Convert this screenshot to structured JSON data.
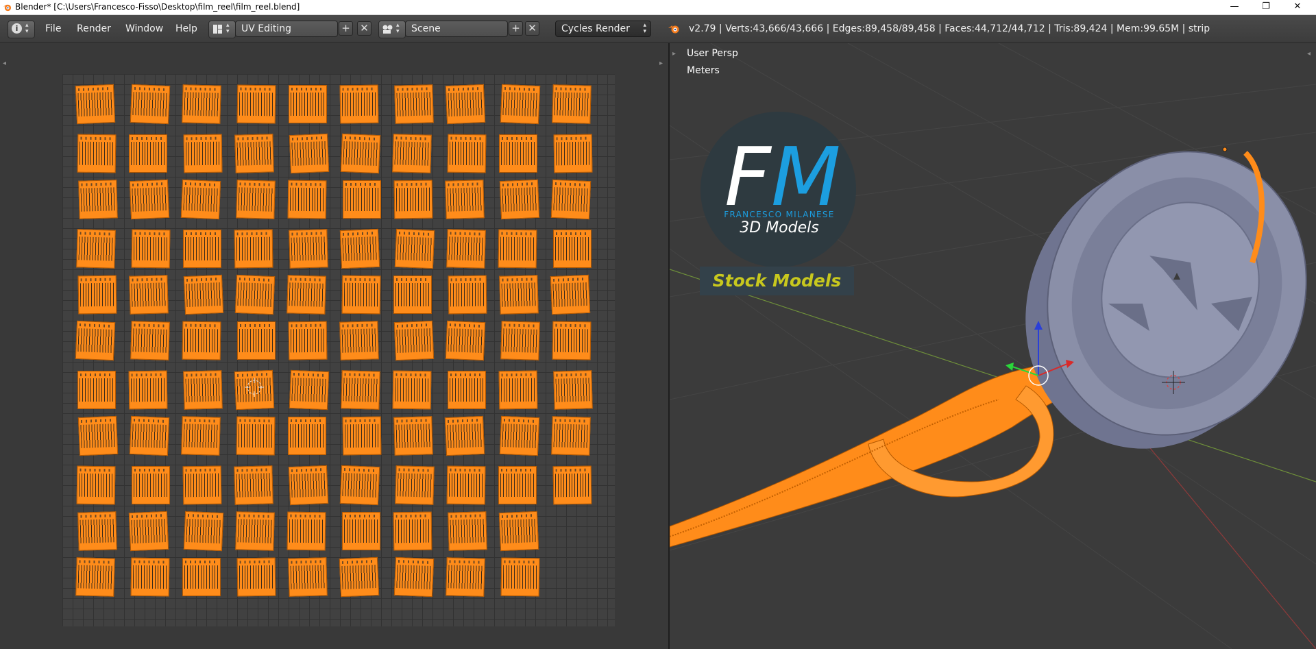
{
  "window": {
    "title": "Blender* [C:\\Users\\Francesco-Fisso\\Desktop\\film_reel\\film_reel.blend]",
    "minimize_glyph": "—",
    "maximize_glyph": "❐",
    "close_glyph": "✕"
  },
  "menu": [
    "File",
    "Render",
    "Window",
    "Help"
  ],
  "header": {
    "info_glyph": "i",
    "screen_layout": "UV Editing",
    "scene": "Scene",
    "render_engine": "Cycles Render",
    "add_glyph": "+",
    "remove_glyph": "✕",
    "stats": "v2.79 | Verts:43,666/43,666 | Edges:89,458/89,458 | Faces:44,712/44,712 | Tris:89,424 | Mem:99.65M | strip"
  },
  "viewport": {
    "view_label": "User Persp",
    "units_label": "Meters",
    "logo_letter_f": "F",
    "logo_letter_m": "M",
    "logo_name": "FRANCESCO MILANESE",
    "logo_sub": "3D Models",
    "stock_label": "Stock Models"
  },
  "uv": {
    "row_counts": [
      10,
      10,
      10,
      10,
      10,
      10,
      10,
      10,
      10,
      9,
      9
    ]
  },
  "colors": {
    "accent": "#ff8c1a",
    "background": "#393939",
    "logo_blue": "#1c9ee0",
    "stock_yellow": "#c8c81e",
    "reel": "#8a8fa8"
  }
}
